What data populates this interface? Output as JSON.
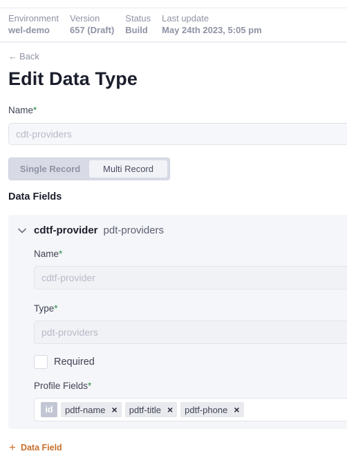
{
  "meta": {
    "environment_label": "Environment",
    "environment_value": "wel-demo",
    "version_label": "Version",
    "version_value": "657 (Draft)",
    "status_label": "Status",
    "status_value": "Build",
    "update_label": "Last update",
    "update_value": "May 24th 2023, 5:05 pm"
  },
  "nav": {
    "back_arrow": "←",
    "back_label": "Back"
  },
  "page": {
    "title": "Edit Data Type"
  },
  "form": {
    "name_label": "Name",
    "required_marker": "*",
    "name_placeholder": "cdt-providers",
    "record_modes": [
      "Single Record",
      "Multi Record"
    ],
    "active_mode": "Multi Record"
  },
  "data_fields": {
    "heading": "Data Fields",
    "field": {
      "id": "cdtf-provider",
      "data_type": "pdt-providers",
      "name_label": "Name",
      "name_placeholder": "cdtf-provider",
      "type_label": "Type",
      "type_placeholder": "pdt-providers",
      "required_label": "Required",
      "required_checked": false,
      "profile_fields_label": "Profile Fields",
      "fixed_tag": "id",
      "tags": [
        "pdtf-name",
        "pdtf-title",
        "pdtf-phone"
      ],
      "remove_glyph": "×"
    },
    "add_label": "Data Field",
    "add_glyph": "+"
  },
  "colors": {
    "accent": "#c8702d",
    "required": "#2a8a4a",
    "text_primary": "#1b1e2b",
    "text_muted": "#8f93a3"
  },
  "icons": {
    "back": "arrow-left-icon",
    "collapse": "chevron-down-icon",
    "remove": "close-icon",
    "add": "plus-icon"
  }
}
